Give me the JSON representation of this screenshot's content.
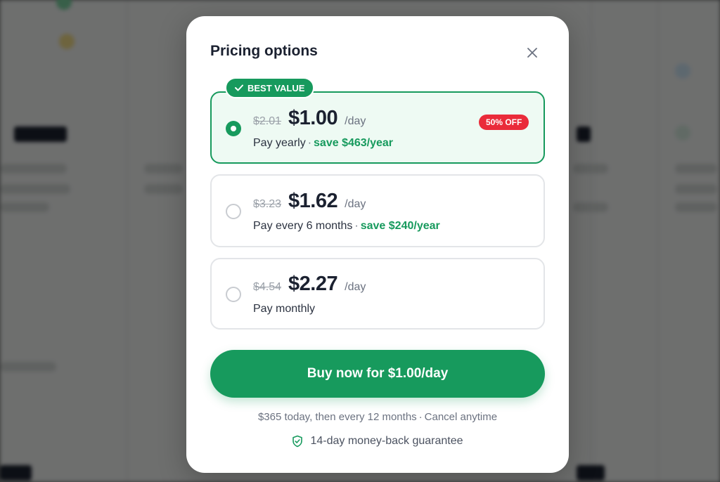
{
  "modal": {
    "title": "Pricing options"
  },
  "plans": [
    {
      "selected": true,
      "badge": "BEST VALUE",
      "discount_badge": "50% OFF",
      "old_price": "$2.01",
      "price": "$1.00",
      "unit": "/day",
      "label": "Pay yearly",
      "savings": "save $463/year"
    },
    {
      "selected": false,
      "old_price": "$3.23",
      "price": "$1.62",
      "unit": "/day",
      "label": "Pay every 6 months",
      "savings": "save $240/year"
    },
    {
      "selected": false,
      "old_price": "$4.54",
      "price": "$2.27",
      "unit": "/day",
      "label": "Pay monthly"
    }
  ],
  "buy_button": {
    "label": "Buy now for $1.00/day"
  },
  "billing_note": {
    "today": "$365 today, then every 12 months",
    "cancel": "Cancel anytime"
  },
  "guarantee": {
    "text": "14-day money-back guarantee"
  },
  "colors": {
    "accent": "#179a5d",
    "discount": "#ea2b3a"
  },
  "icons": [
    "close-icon",
    "check-icon",
    "shield-check-icon"
  ]
}
